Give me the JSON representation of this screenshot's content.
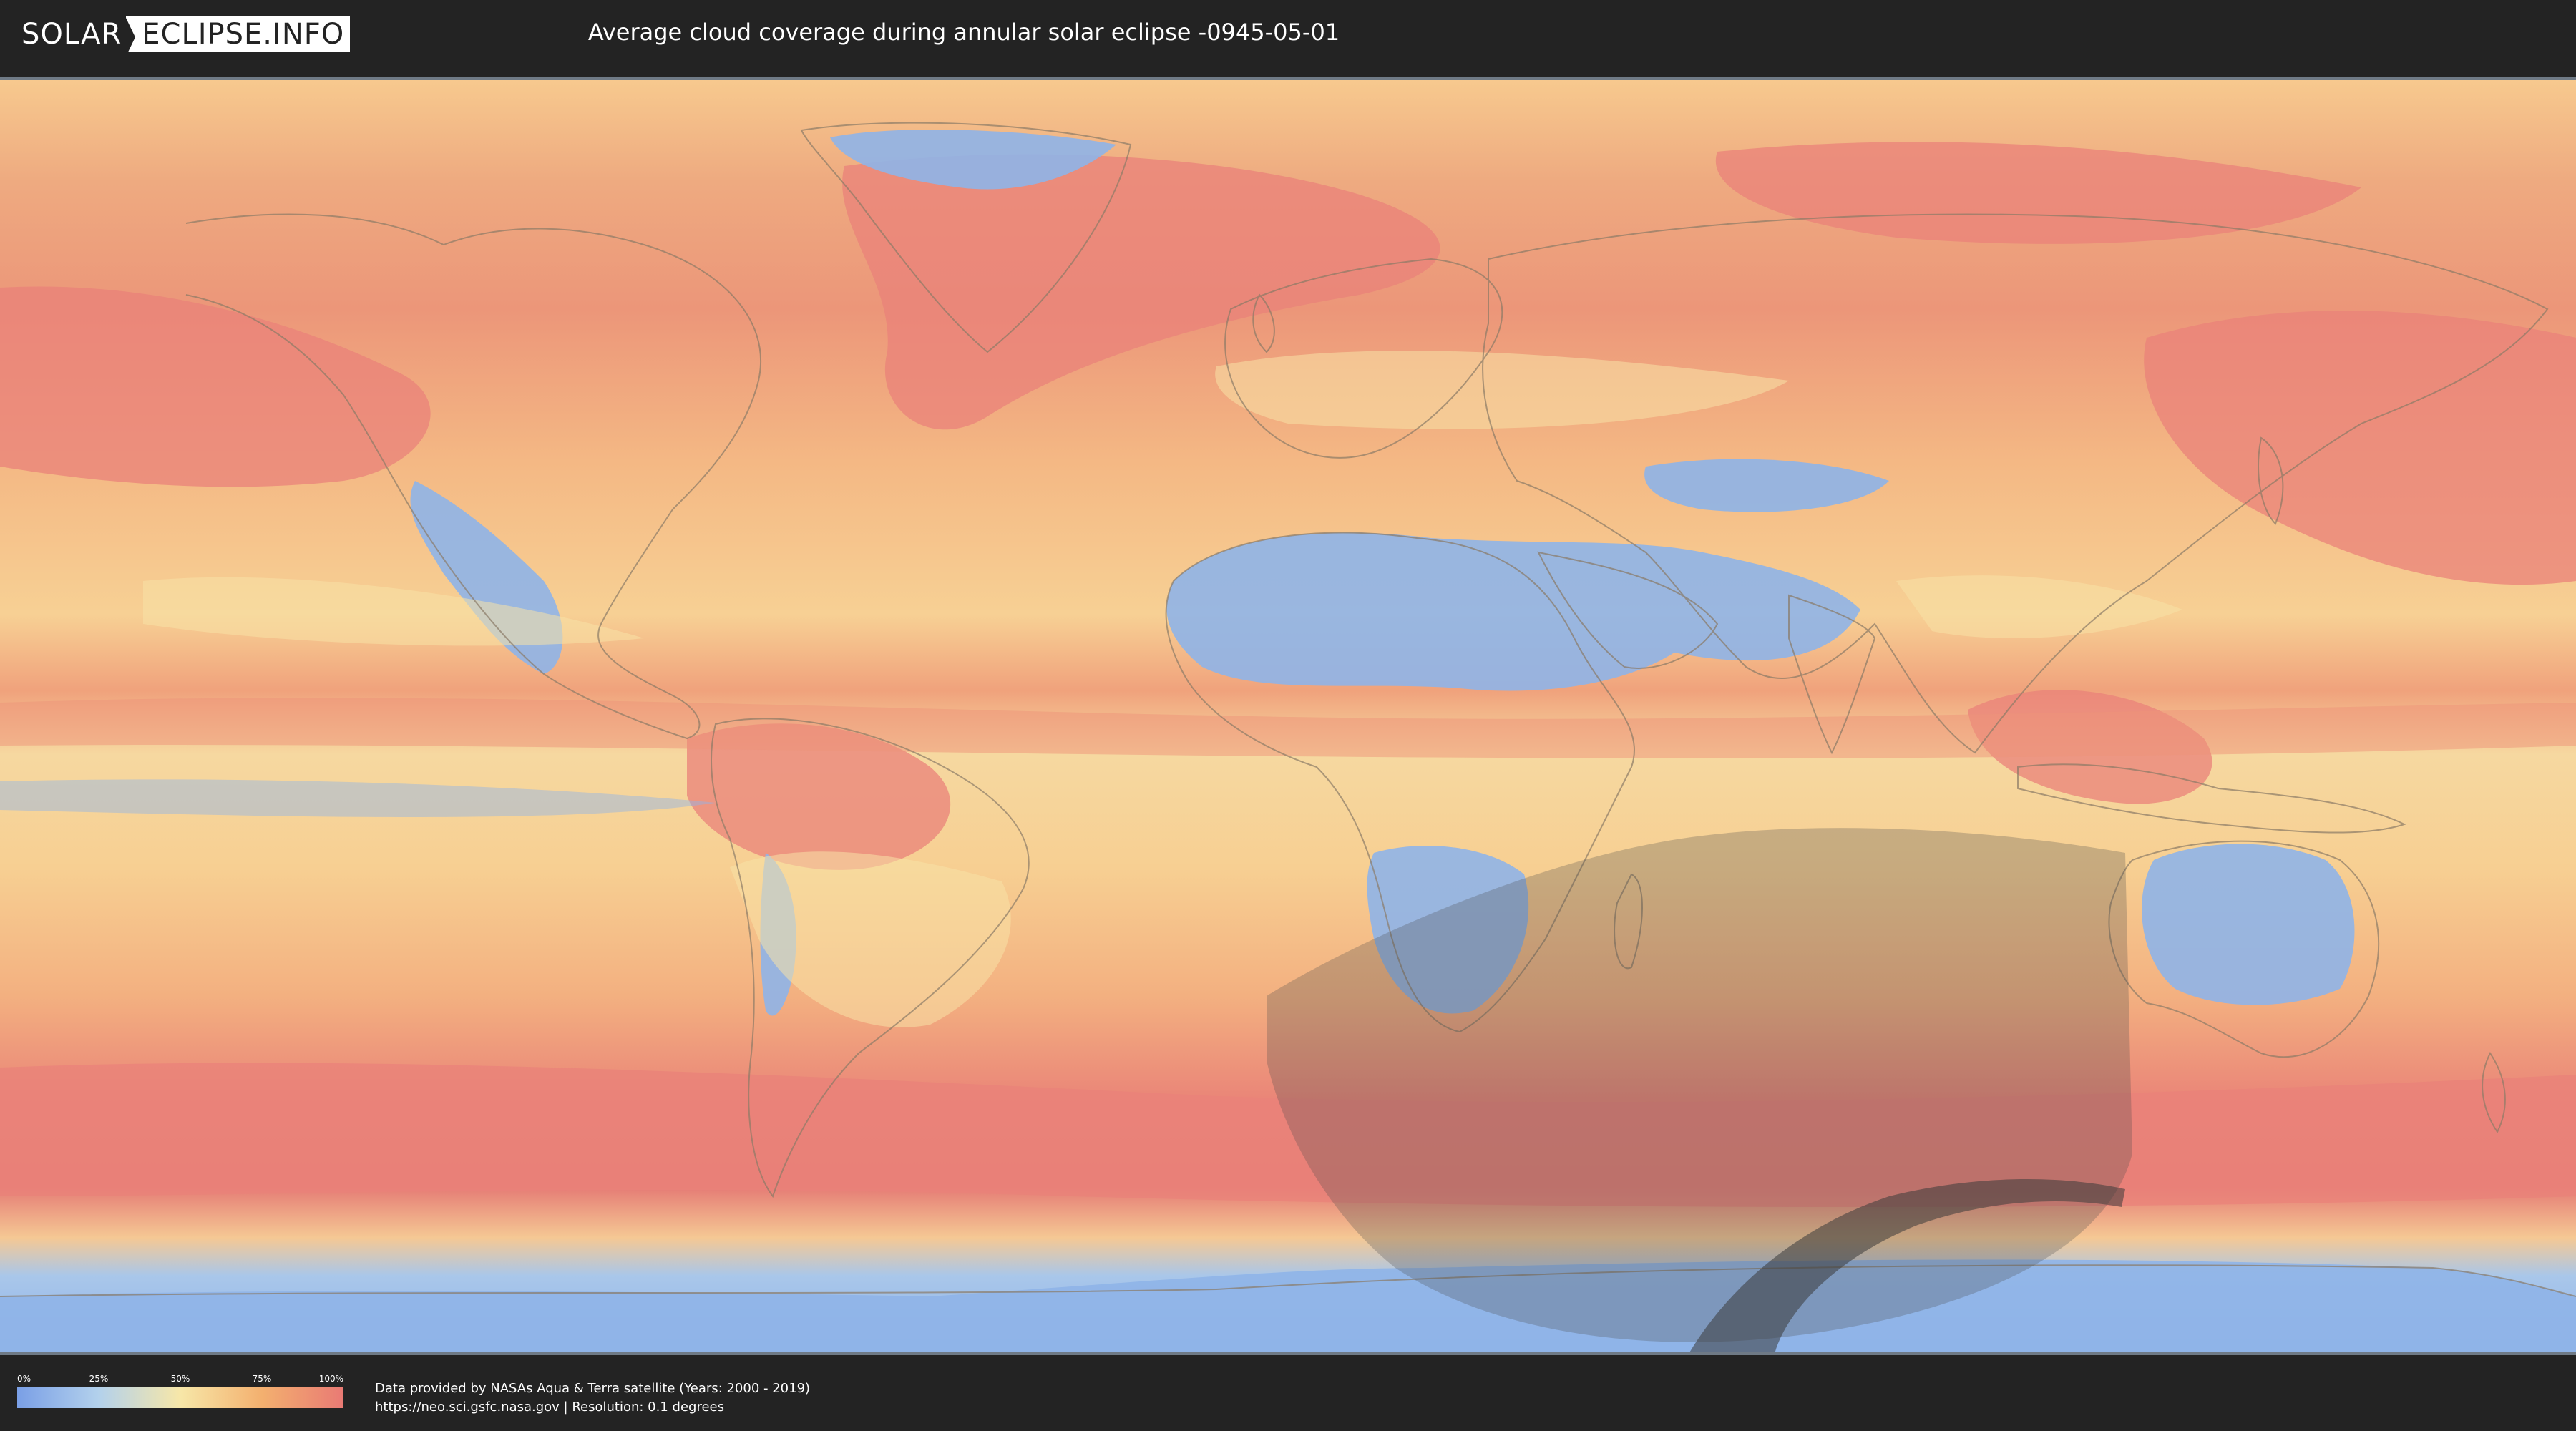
{
  "header": {
    "logo_left": "SOLAR",
    "logo_right": "ECLIPSE.INFO",
    "title": "Average cloud coverage during annular solar eclipse -0945-05-01"
  },
  "legend": {
    "ticks": [
      "0%",
      "25%",
      "50%",
      "75%",
      "100%"
    ],
    "colors": [
      "#7a9fe6",
      "#b3d1ec",
      "#f7e7a8",
      "#f3b06f",
      "#e97a74"
    ]
  },
  "footer": {
    "source_line1": "Data provided by NASAs Aqua & Terra satellite (Years: 2000 - 2019)",
    "source_line2": "https://neo.sci.gsfc.nasa.gov | Resolution: 0.1 degrees"
  },
  "map": {
    "projection": "equirectangular",
    "layer": "cloud-coverage",
    "eclipse_overlay": "penumbra-and-annularity-path"
  }
}
